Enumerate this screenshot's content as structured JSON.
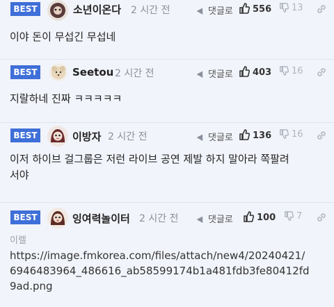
{
  "comments": [
    {
      "badge": "BEST",
      "nickname": "소년이온다",
      "time": "2 시간 전",
      "reply_label": "댓글로",
      "upvotes": "556",
      "downvotes": "13",
      "text": "이야 돈이 무섭긴 무섭네"
    },
    {
      "badge": "BEST",
      "nickname": "Seetou",
      "time": "2 시간 전",
      "reply_label": "댓글로",
      "upvotes": "403",
      "downvotes": "16",
      "text": "지랄하네 진짜 ㅋㅋㅋㅋㅋ"
    },
    {
      "badge": "BEST",
      "nickname": "이방자",
      "time": "2 시간 전",
      "reply_label": "댓글로",
      "upvotes": "136",
      "downvotes": "16",
      "text_line1": "이저 하이브 걸그룹은 저런 라이브 공연 제발 하지 말아라 쪽팔려",
      "text_line2": "서야"
    },
    {
      "badge": "BEST",
      "nickname": "잉여력놀이터",
      "time": "2 시간 전",
      "reply_label": "댓글로",
      "upvotes": "100",
      "downvotes": "7",
      "image_label": "이렐",
      "url_line1": "https://image.fmkorea.com/files/attach/new4/20240421/",
      "url_line2": "6946483964_486616_ab58599174b1a481fdb3fe80412fd",
      "url_line3": "9ad.png"
    }
  ],
  "colors": {
    "badge": "#3f6fd8",
    "background": "#f2f4fb"
  }
}
